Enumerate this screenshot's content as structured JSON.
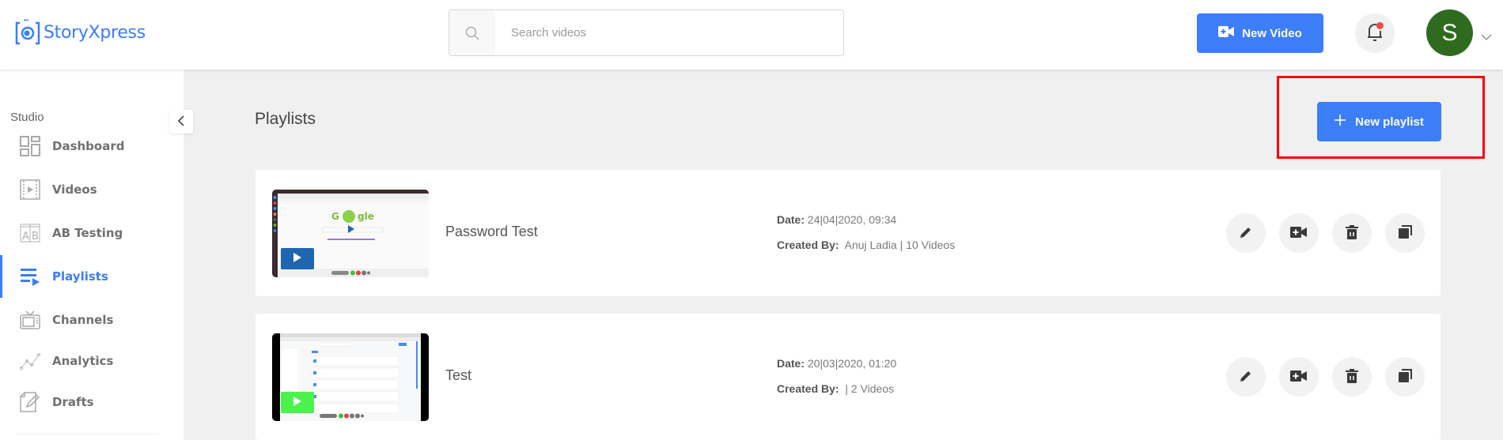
{
  "header": {
    "logo_text": "StoryXpress",
    "search_placeholder": "Search videos",
    "search_value": "",
    "new_video_label": "New Video",
    "avatar_initial": "S",
    "notification_dot": true
  },
  "sidebar": {
    "section_label": "Studio",
    "items": [
      {
        "label": "Dashboard",
        "icon": "dashboard-icon",
        "active": false
      },
      {
        "label": "Videos",
        "icon": "video-file-icon",
        "active": false
      },
      {
        "label": "AB Testing",
        "icon": "ab-testing-icon",
        "active": false
      },
      {
        "label": "Playlists",
        "icon": "playlist-icon",
        "active": true
      },
      {
        "label": "Channels",
        "icon": "tv-icon",
        "active": false
      },
      {
        "label": "Analytics",
        "icon": "analytics-icon",
        "active": false
      },
      {
        "label": "Drafts",
        "icon": "drafts-icon",
        "active": false
      }
    ]
  },
  "main": {
    "page_title": "Playlists",
    "new_playlist_label": "New playlist",
    "playlists": [
      {
        "title": "Password Test",
        "date_label": "Date:",
        "date": "24|04|2020, 09:34",
        "created_by_label": "Created By:",
        "created_by": "Anuj Ladia | 10 Videos",
        "play_color": "#1f66b0"
      },
      {
        "title": "Test",
        "date_label": "Date:",
        "date": "20|03|2020, 01:20",
        "created_by_label": "Created By:",
        "created_by": " | 2 Videos",
        "play_color": "#4cf24c"
      }
    ],
    "actions": [
      "edit-icon",
      "add-video-icon",
      "delete-icon",
      "copy-icon"
    ]
  },
  "colors": {
    "accent": "#3b7ef7",
    "highlight": "#ff0000",
    "avatar_bg": "#2f6b1f",
    "notification": "#f04b4b"
  }
}
